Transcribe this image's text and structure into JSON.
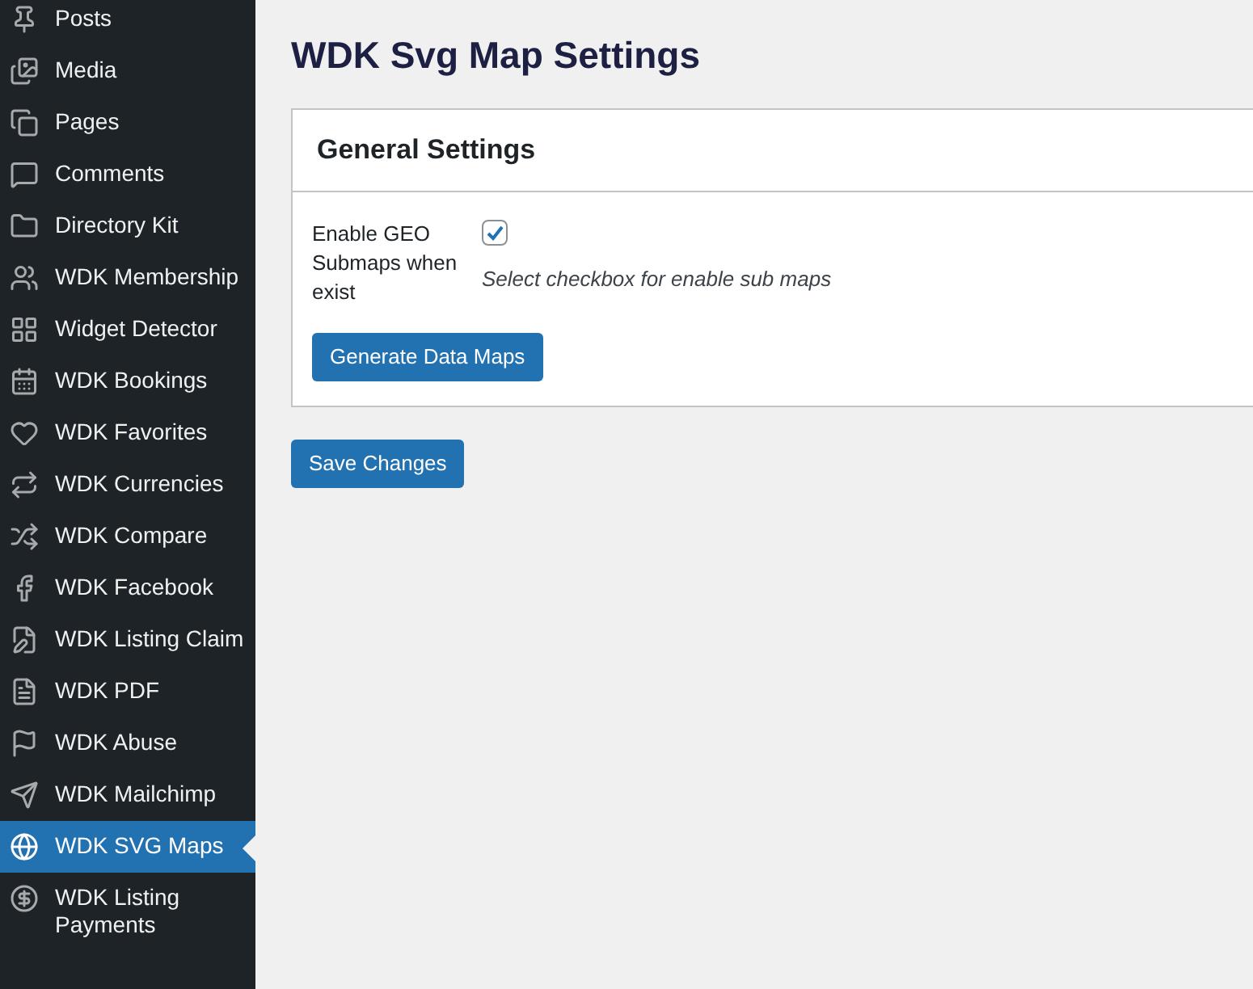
{
  "sidebar": {
    "items": [
      {
        "label": "Posts",
        "selected": false
      },
      {
        "label": "Media",
        "selected": false
      },
      {
        "label": "Pages",
        "selected": false
      },
      {
        "label": "Comments",
        "selected": false
      },
      {
        "label": "Directory Kit",
        "selected": false
      },
      {
        "label": "WDK Membership",
        "selected": false
      },
      {
        "label": "Widget Detector",
        "selected": false
      },
      {
        "label": "WDK Bookings",
        "selected": false
      },
      {
        "label": "WDK Favorites",
        "selected": false
      },
      {
        "label": "WDK Currencies",
        "selected": false
      },
      {
        "label": "WDK Compare",
        "selected": false
      },
      {
        "label": "WDK Facebook",
        "selected": false
      },
      {
        "label": "WDK Listing Claim",
        "selected": false
      },
      {
        "label": "WDK PDF",
        "selected": false
      },
      {
        "label": "WDK Abuse",
        "selected": false
      },
      {
        "label": "WDK Mailchimp",
        "selected": false
      },
      {
        "label": "WDK SVG Maps",
        "selected": true
      },
      {
        "label": "WDK Listing Payments",
        "selected": false
      }
    ]
  },
  "page_title": "WDK Svg Map Settings",
  "panel": {
    "title": "General Settings",
    "fields": [
      {
        "label": "Enable GEO Submaps when exist",
        "checked": true,
        "description": "Select checkbox for enable sub maps"
      }
    ],
    "button": "Generate Data Maps"
  },
  "save_button": "Save Changes"
}
